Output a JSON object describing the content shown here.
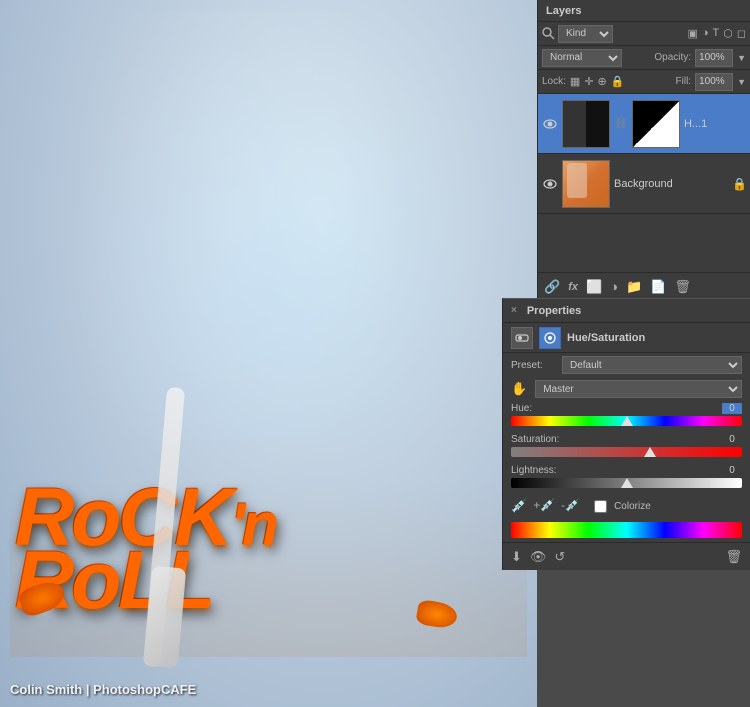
{
  "canvas": {
    "watermark": "Colin Smith | PhotoshopCAFE",
    "rock_text": "Rock'n Roll"
  },
  "layers_panel": {
    "title": "Layers",
    "toolbar": {
      "kind_label": "Kind",
      "blend_mode": "Normal",
      "opacity_label": "Opacity:",
      "opacity_value": "100%",
      "lock_label": "Lock:",
      "fill_label": "Fill:",
      "fill_value": "100%"
    },
    "layers": [
      {
        "name": "H...1",
        "visible": true,
        "selected": true,
        "type": "adjustment",
        "has_mask": true
      },
      {
        "name": "Background",
        "visible": true,
        "selected": false,
        "type": "image",
        "locked": true
      }
    ],
    "bottom_icons": [
      "link-icon",
      "fx-icon",
      "mask-icon",
      "group-icon",
      "new-layer-icon",
      "delete-icon"
    ]
  },
  "properties_panel": {
    "title": "Properties",
    "close_label": "×",
    "subtitle": "Hue/Saturation",
    "preset_label": "Preset:",
    "preset_value": "Default",
    "channel_value": "Master",
    "hue_label": "Hue:",
    "hue_value": "0",
    "saturation_label": "Saturation:",
    "saturation_value": "0",
    "lightness_label": "Lightness:",
    "lightness_value": "0",
    "colorize_label": "Colorize",
    "hue_slider_pct": "50",
    "sat_slider_pct": "60",
    "light_slider_pct": "50",
    "bottom_icons": [
      "clip-icon",
      "eye-icon",
      "reset-icon",
      "delete-icon"
    ]
  }
}
